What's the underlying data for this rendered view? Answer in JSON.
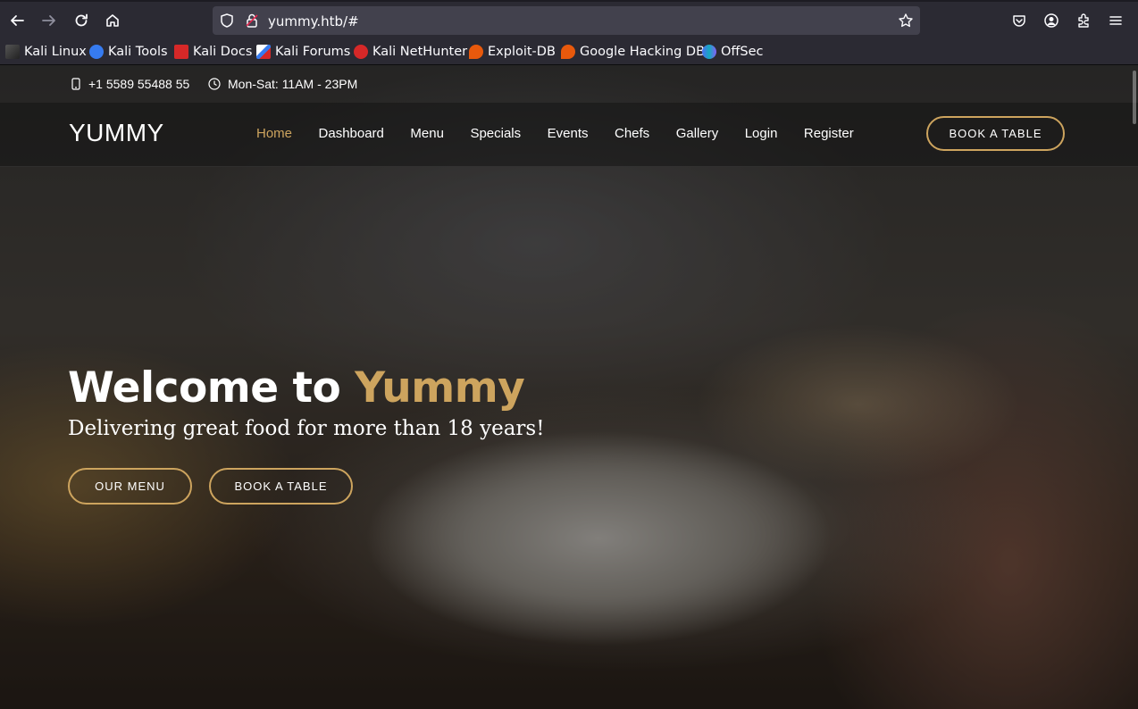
{
  "browser": {
    "url": "yummy.htb/#",
    "bookmarks": [
      {
        "label": "Kali Linux",
        "icon": "kali-linux-icon",
        "color": "#367bf0"
      },
      {
        "label": "Kali Tools",
        "icon": "kali-tools-icon",
        "color": "#367bf0"
      },
      {
        "label": "Kali Docs",
        "icon": "kali-docs-icon",
        "color": "#d62828"
      },
      {
        "label": "Kali Forums",
        "icon": "kali-forums-icon",
        "color": "#367bf0"
      },
      {
        "label": "Kali NetHunter",
        "icon": "kali-nethunter-icon",
        "color": "#d62828"
      },
      {
        "label": "Exploit-DB",
        "icon": "exploit-db-icon",
        "color": "#e8590c"
      },
      {
        "label": "Google Hacking DB",
        "icon": "ghdb-icon",
        "color": "#e8590c"
      },
      {
        "label": "OffSec",
        "icon": "offsec-icon",
        "color": "#4c6ef5"
      }
    ]
  },
  "site": {
    "topbar": {
      "phone": "+1 5589 55488 55",
      "hours": "Mon-Sat: 11AM - 23PM"
    },
    "logo": "YUMMY",
    "nav": [
      "Home",
      "Dashboard",
      "Menu",
      "Specials",
      "Events",
      "Chefs",
      "Gallery",
      "Login",
      "Register"
    ],
    "active_nav": "Home",
    "book_button": "BOOK A TABLE",
    "hero": {
      "title_prefix": "Welcome to ",
      "title_accent": "Yummy",
      "subtitle": "Delivering great food for more than 18 years!",
      "menu_button": "OUR MENU",
      "book_button": "BOOK A TABLE"
    },
    "accent_color": "#cda45e"
  }
}
